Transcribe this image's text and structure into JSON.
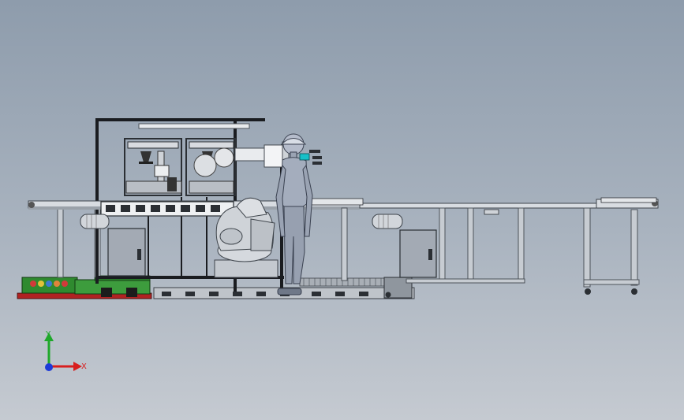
{
  "triad": {
    "y_label": "Y",
    "x_label": "X",
    "colors": {
      "y": "#1fa82a",
      "x": "#d81e1e",
      "z": "#1d3bd8"
    }
  },
  "palette": {
    "frame_dark": "#1a1c20",
    "aluminum": "#c7ccd2",
    "aluminum_edge": "#4d535a",
    "cabinet": "#a3aab4",
    "green_base": "#2f8a2f",
    "red_base": "#b02222",
    "robot": "#cfd3d8",
    "person": "#9aa3b3",
    "helmet_accent": "#18c0c8"
  }
}
